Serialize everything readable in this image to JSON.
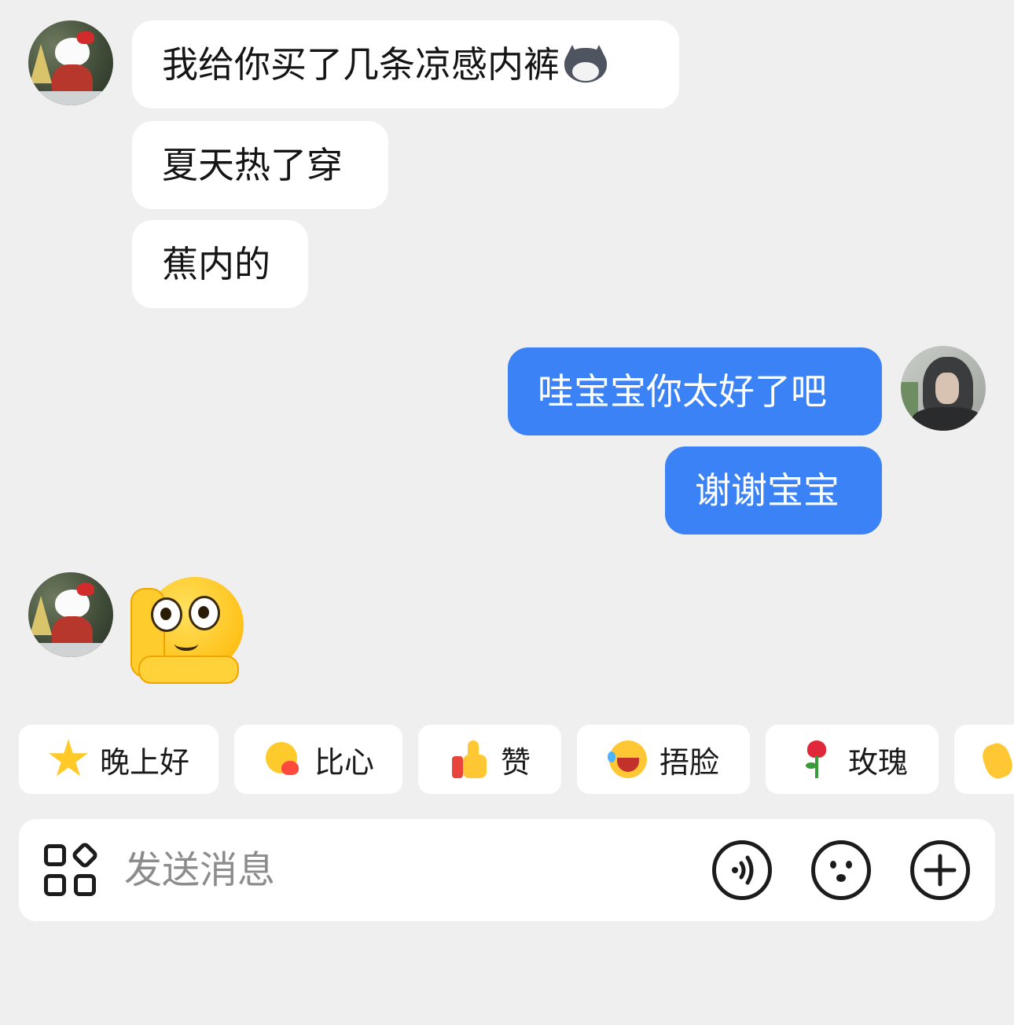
{
  "messages": {
    "incoming_1": "我给你买了几条凉感内裤",
    "incoming_2": "夏天热了穿",
    "incoming_3": "蕉内的",
    "outgoing_1": "哇宝宝你太好了吧",
    "outgoing_2": "谢谢宝宝"
  },
  "quick_replies": [
    {
      "label": "晚上好",
      "icon": "star-icon"
    },
    {
      "label": "比心",
      "icon": "heart-face-icon"
    },
    {
      "label": "赞",
      "icon": "thumbs-up-icon"
    },
    {
      "label": "捂脸",
      "icon": "laughing-tears-icon"
    },
    {
      "label": "玫瑰",
      "icon": "rose-icon"
    },
    {
      "label": "",
      "icon": "clapping-hands-icon"
    }
  ],
  "input": {
    "placeholder": "发送消息"
  },
  "colors": {
    "background": "#efeff0",
    "outgoing_bubble": "#3a82f6",
    "incoming_bubble": "#ffffff"
  }
}
